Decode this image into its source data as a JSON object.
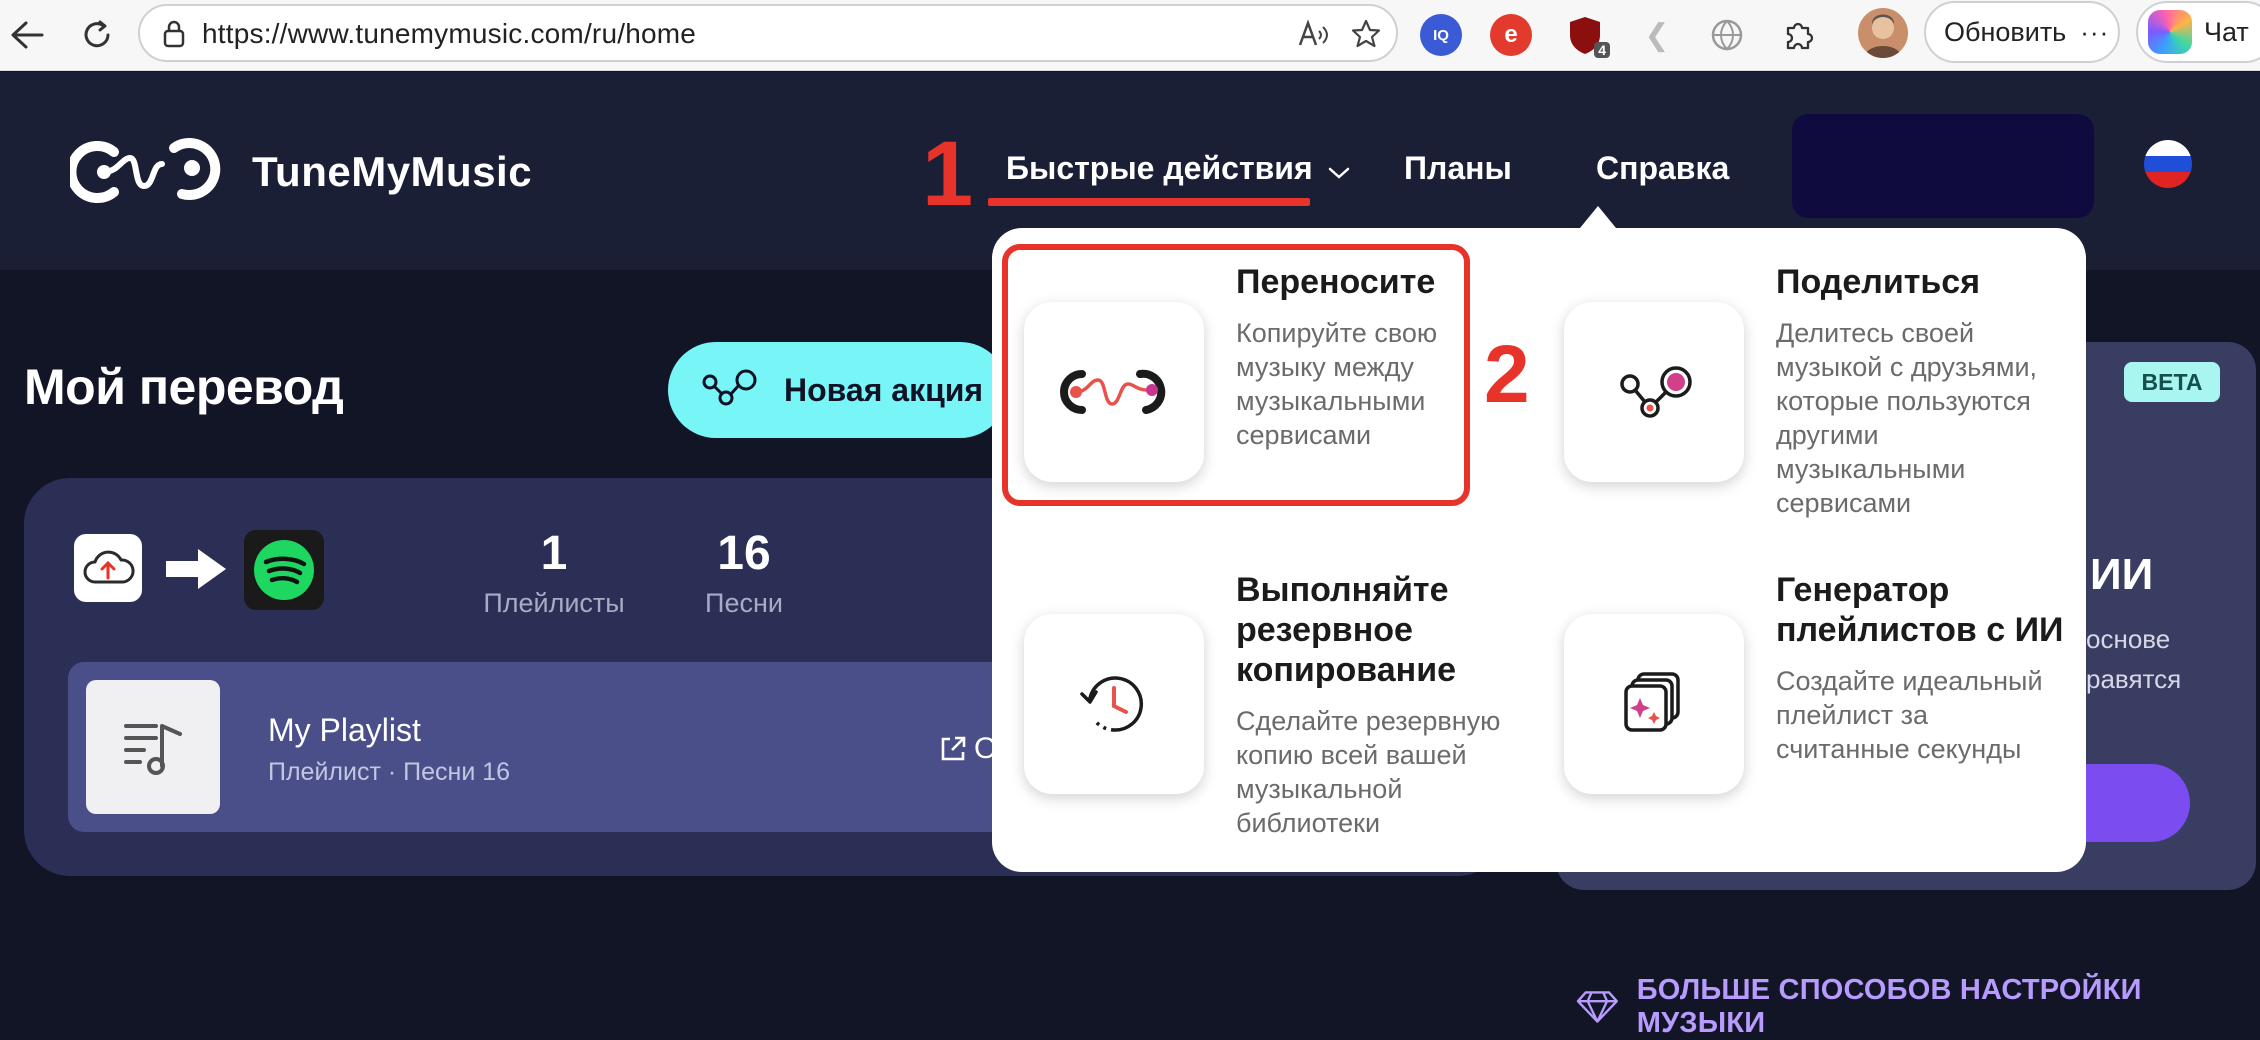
{
  "browser": {
    "url": "https://www.tunemymusic.com/ru/home",
    "refresh_label": "Обновить",
    "more_label": "···",
    "chat_label": "Чат",
    "ext_iq": "IQ",
    "ext_badge": "4"
  },
  "site": {
    "logo_text": "TuneMyMusic",
    "nav": {
      "quick_actions": "Быстрые действия",
      "plans": "Планы",
      "help": "Справка"
    },
    "annotations": {
      "one": "1",
      "two": "2"
    }
  },
  "main": {
    "title": "Мой перевод",
    "new_action": "Новая акция",
    "stats": [
      {
        "value": "1",
        "label": "Плейлисты"
      },
      {
        "value": "16",
        "label": "Песни"
      }
    ],
    "playlist": {
      "name": "My Playlist",
      "meta": "Плейлист · Песни 16",
      "open_fragment": "О"
    },
    "ai_card": {
      "beta": "BETA",
      "title_fragment": "ИИ",
      "text_fragment_1": "основе",
      "text_fragment_2": "равятся"
    },
    "more_link": "БОЛЬШЕ СПОСОБОВ НАСТРОЙКИ МУЗЫКИ"
  },
  "dropdown": {
    "transfer": {
      "title": "Переносите",
      "desc": [
        "Копируйте свою",
        "музыку между",
        "музыкальными",
        "сервисами"
      ]
    },
    "share": {
      "title": "Поделиться",
      "desc": [
        "Делитесь своей",
        "музыкой с друзьями,",
        "которые пользуются",
        "другими",
        "музыкальными",
        "сервисами"
      ]
    },
    "backup": {
      "title": [
        "Выполняйте",
        "резервное",
        "копирование"
      ],
      "desc": [
        "Сделайте резервную",
        "копию всей вашей",
        "музыкальной",
        "библиотеки"
      ]
    },
    "generator": {
      "title": [
        "Генератор",
        "плейлистов с ИИ"
      ],
      "desc": [
        "Создайте идеальный",
        "плейлист за",
        "считанные секунды"
      ]
    }
  },
  "colors": {
    "accent_red": "#e8332a",
    "cyan": "#77f5f7",
    "purple": "#7b4cf0",
    "bg": "#121526"
  }
}
